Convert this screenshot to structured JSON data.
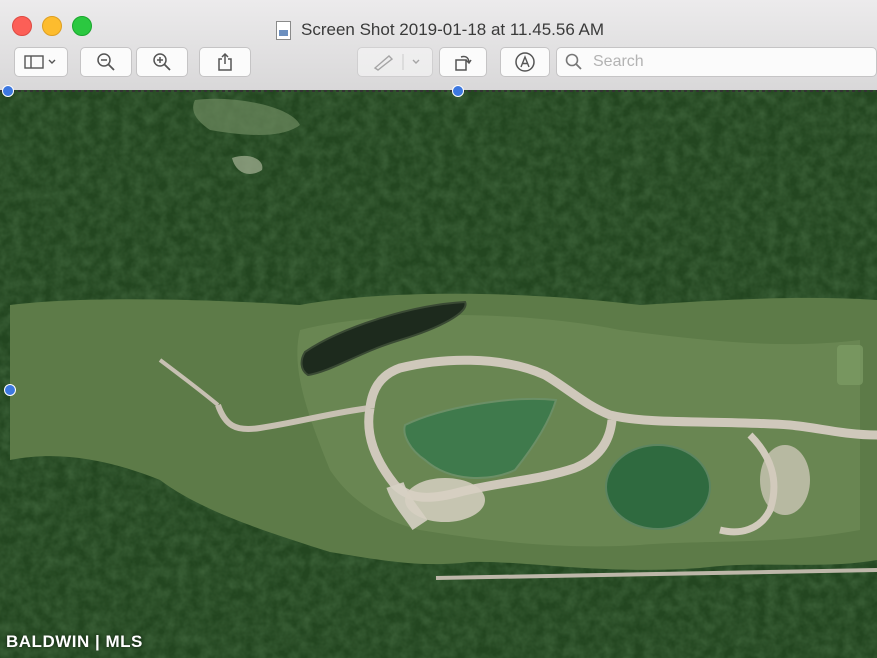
{
  "window": {
    "title": "Screen Shot 2019-01-18 at 11.45.56 AM"
  },
  "toolbar": {
    "search_placeholder": "Search",
    "icons": [
      "sidebar-icon",
      "zoom-out-icon",
      "zoom-in-icon",
      "share-icon",
      "markup-pen-icon",
      "rotate-icon",
      "annotate-icon",
      "search-icon"
    ]
  },
  "image": {
    "description_type": "aerial-satellite-view",
    "watermark": "BALDWIN | MLS"
  },
  "colors": {
    "forest": "#20401d",
    "clearing": "#5f7a4a",
    "road": "#c9c2b6",
    "pond": "#3f7a4c",
    "selection_handle": "#3d78e0"
  }
}
